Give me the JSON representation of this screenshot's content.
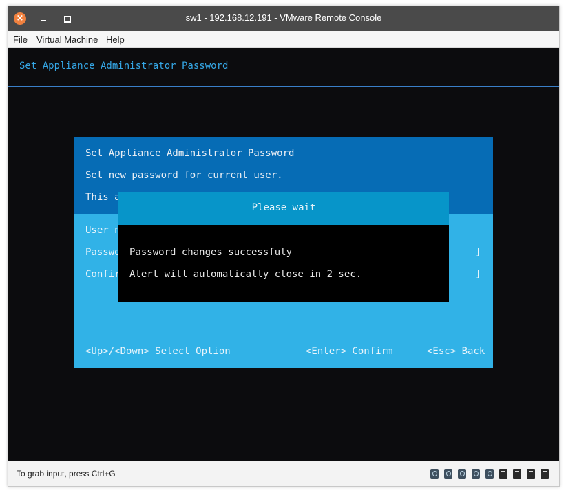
{
  "window": {
    "title": "sw1 - 192.168.12.191 - VMware Remote Console"
  },
  "menu": [
    "File",
    "Virtual Machine",
    "Help"
  ],
  "console": {
    "header": "Set Appliance Administrator Password",
    "dialog": {
      "title": "Set Appliance Administrator Password",
      "line1": "Set new password for current user.",
      "line2_partial": "This a",
      "user_label_partial": "User n",
      "password_label_partial": "Passwo",
      "confirm_label_partial": "Confir",
      "bracket1": "]",
      "bracket2": "]",
      "footer_select": "<Up>/<Down> Select Option",
      "footer_confirm": "<Enter> Confirm",
      "footer_back": "<Esc> Back"
    },
    "alert": {
      "title": "Please wait",
      "message1": "Password changes successfuly",
      "message2": "Alert will automatically close in 2 sec."
    }
  },
  "statusbar": {
    "hint": "To grab input, press Ctrl+G",
    "devices": [
      "network-icon",
      "network-icon",
      "network-icon",
      "network-icon",
      "network-icon",
      "usb-icon",
      "usb-icon",
      "usb-icon",
      "usb-icon",
      "disk-icon"
    ]
  }
}
